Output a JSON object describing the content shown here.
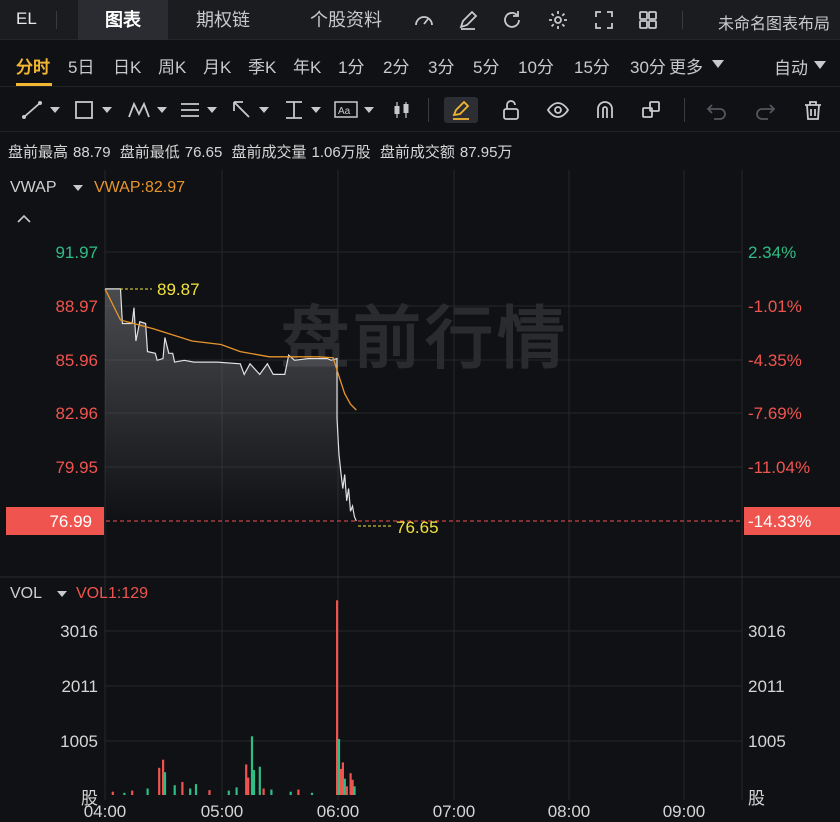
{
  "topbar": {
    "ticker": "EL",
    "tabs": [
      {
        "label": "图表",
        "active": true
      },
      {
        "label": "期权链",
        "active": false
      },
      {
        "label": "个股资料",
        "active": false
      }
    ],
    "layout_name": "未命名图表布局"
  },
  "periods": {
    "items": [
      "分时",
      "5日",
      "日K",
      "周K",
      "月K",
      "季K",
      "年K",
      "1分",
      "2分",
      "3分",
      "5分",
      "10分",
      "15分",
      "30分",
      "更多"
    ],
    "active": "分时",
    "auto_label": "自动"
  },
  "info": {
    "pre_high_label": "盘前最高",
    "pre_high": "88.79",
    "pre_low_label": "盘前最低",
    "pre_low": "76.65",
    "pre_vol_label": "盘前成交量",
    "pre_vol": "1.06万股",
    "pre_amount_label": "盘前成交额",
    "pre_amount": "87.95万"
  },
  "main_panel": {
    "indicator_label": "VWAP",
    "indicator_value": "VWAP:82.97",
    "watermark": "盘前行情",
    "price_levels": [
      "91.97",
      "88.97",
      "85.96",
      "82.96",
      "79.95"
    ],
    "pct_levels": [
      "2.34%",
      "-1.01%",
      "-4.35%",
      "-7.69%",
      "-11.04%"
    ],
    "current_price": "76.99",
    "current_pct": "-14.33%",
    "high_marker": "89.87",
    "low_marker": "76.65"
  },
  "vol_panel": {
    "indicator_label": "VOL",
    "indicator_value": "VOL1:129",
    "levels": [
      "3016",
      "2011",
      "1005"
    ],
    "unit": "股"
  },
  "time_axis": [
    "04:00",
    "05:00",
    "06:00",
    "07:00",
    "08:00",
    "09:00"
  ],
  "colors": {
    "up": "#2ebd85",
    "down": "#f0544f",
    "vwap": "#e8952c",
    "price": "#e0e0e0",
    "accent": "#f2b632"
  },
  "chart_data": {
    "type": "line",
    "x_axis": [
      "04:00",
      "05:00",
      "06:00",
      "07:00",
      "08:00",
      "09:00"
    ],
    "ylim": [
      76.65,
      91.97
    ],
    "price": [
      {
        "t": "04:00",
        "v": 89.87
      },
      {
        "t": "04:08",
        "v": 89.87
      },
      {
        "t": "04:09",
        "v": 87.9
      },
      {
        "t": "04:14",
        "v": 87.9
      },
      {
        "t": "04:15",
        "v": 88.8
      },
      {
        "t": "04:16",
        "v": 86.9
      },
      {
        "t": "04:18",
        "v": 88.0
      },
      {
        "t": "04:21",
        "v": 87.9
      },
      {
        "t": "04:22",
        "v": 86.3
      },
      {
        "t": "04:26",
        "v": 86.2
      },
      {
        "t": "04:27",
        "v": 85.8
      },
      {
        "t": "04:30",
        "v": 85.9
      },
      {
        "t": "04:31",
        "v": 87.1
      },
      {
        "t": "04:33",
        "v": 86.2
      },
      {
        "t": "04:35",
        "v": 86.2
      },
      {
        "t": "04:36",
        "v": 85.7
      },
      {
        "t": "04:41",
        "v": 85.8
      },
      {
        "t": "04:46",
        "v": 85.7
      },
      {
        "t": "04:56",
        "v": 85.7
      },
      {
        "t": "04:58",
        "v": 85.7
      },
      {
        "t": "05:10",
        "v": 85.6
      },
      {
        "t": "05:12",
        "v": 85.0
      },
      {
        "t": "05:15",
        "v": 85.6
      },
      {
        "t": "05:20",
        "v": 85.0
      },
      {
        "t": "05:24",
        "v": 85.6
      },
      {
        "t": "05:27",
        "v": 85.0
      },
      {
        "t": "05:33",
        "v": 85.0
      },
      {
        "t": "05:35",
        "v": 86.1
      },
      {
        "t": "05:38",
        "v": 85.8
      },
      {
        "t": "05:45",
        "v": 85.9
      },
      {
        "t": "05:55",
        "v": 85.9
      },
      {
        "t": "05:57",
        "v": 85.8
      },
      {
        "t": "06:00",
        "v": 85.9
      },
      {
        "t": "06:00",
        "v": 82.5
      },
      {
        "t": "06:01",
        "v": 80.5
      },
      {
        "t": "06:02",
        "v": 79.4
      },
      {
        "t": "06:03",
        "v": 78.5
      },
      {
        "t": "06:04",
        "v": 79.3
      },
      {
        "t": "06:05",
        "v": 77.8
      },
      {
        "t": "06:06",
        "v": 78.5
      },
      {
        "t": "06:07",
        "v": 77.2
      },
      {
        "t": "06:08",
        "v": 77.5
      },
      {
        "t": "06:09",
        "v": 76.9
      },
      {
        "t": "06:10",
        "v": 76.65
      }
    ],
    "vwap": [
      {
        "t": "04:00",
        "v": 89.87
      },
      {
        "t": "04:08",
        "v": 88.1
      },
      {
        "t": "04:25",
        "v": 87.6
      },
      {
        "t": "04:45",
        "v": 86.9
      },
      {
        "t": "05:00",
        "v": 86.7
      },
      {
        "t": "05:10",
        "v": 86.3
      },
      {
        "t": "05:25",
        "v": 86.0
      },
      {
        "t": "05:50",
        "v": 86.0
      },
      {
        "t": "05:58",
        "v": 85.95
      },
      {
        "t": "06:01",
        "v": 84.9
      },
      {
        "t": "06:04",
        "v": 83.9
      },
      {
        "t": "06:07",
        "v": 83.3
      },
      {
        "t": "06:10",
        "v": 82.97
      }
    ],
    "volume": [
      {
        "t": "04:04",
        "v": 60,
        "c": "down"
      },
      {
        "t": "04:10",
        "v": 40,
        "c": "up"
      },
      {
        "t": "04:14",
        "v": 80,
        "c": "down"
      },
      {
        "t": "04:22",
        "v": 120,
        "c": "up"
      },
      {
        "t": "04:28",
        "v": 500,
        "c": "down"
      },
      {
        "t": "04:30",
        "v": 650,
        "c": "down"
      },
      {
        "t": "04:31",
        "v": 420,
        "c": "up"
      },
      {
        "t": "04:36",
        "v": 180,
        "c": "up"
      },
      {
        "t": "04:40",
        "v": 240,
        "c": "down"
      },
      {
        "t": "04:44",
        "v": 120,
        "c": "up"
      },
      {
        "t": "04:47",
        "v": 200,
        "c": "up"
      },
      {
        "t": "04:54",
        "v": 90,
        "c": "down"
      },
      {
        "t": "05:04",
        "v": 80,
        "c": "up"
      },
      {
        "t": "05:08",
        "v": 140,
        "c": "up"
      },
      {
        "t": "05:13",
        "v": 560,
        "c": "down"
      },
      {
        "t": "05:14",
        "v": 320,
        "c": "down"
      },
      {
        "t": "05:16",
        "v": 1080,
        "c": "up"
      },
      {
        "t": "05:17",
        "v": 460,
        "c": "up"
      },
      {
        "t": "05:20",
        "v": 520,
        "c": "up"
      },
      {
        "t": "05:22",
        "v": 120,
        "c": "down"
      },
      {
        "t": "05:26",
        "v": 100,
        "c": "up"
      },
      {
        "t": "05:36",
        "v": 60,
        "c": "up"
      },
      {
        "t": "05:40",
        "v": 100,
        "c": "down"
      },
      {
        "t": "05:47",
        "v": 40,
        "c": "up"
      },
      {
        "t": "06:00",
        "v": 3580,
        "c": "down"
      },
      {
        "t": "06:01",
        "v": 1030,
        "c": "up"
      },
      {
        "t": "06:02",
        "v": 480,
        "c": "down"
      },
      {
        "t": "06:03",
        "v": 600,
        "c": "down"
      },
      {
        "t": "06:04",
        "v": 300,
        "c": "up"
      },
      {
        "t": "06:05",
        "v": 160,
        "c": "down"
      },
      {
        "t": "06:07",
        "v": 400,
        "c": "down"
      },
      {
        "t": "06:08",
        "v": 280,
        "c": "down"
      },
      {
        "t": "06:09",
        "v": 160,
        "c": "up"
      }
    ]
  }
}
